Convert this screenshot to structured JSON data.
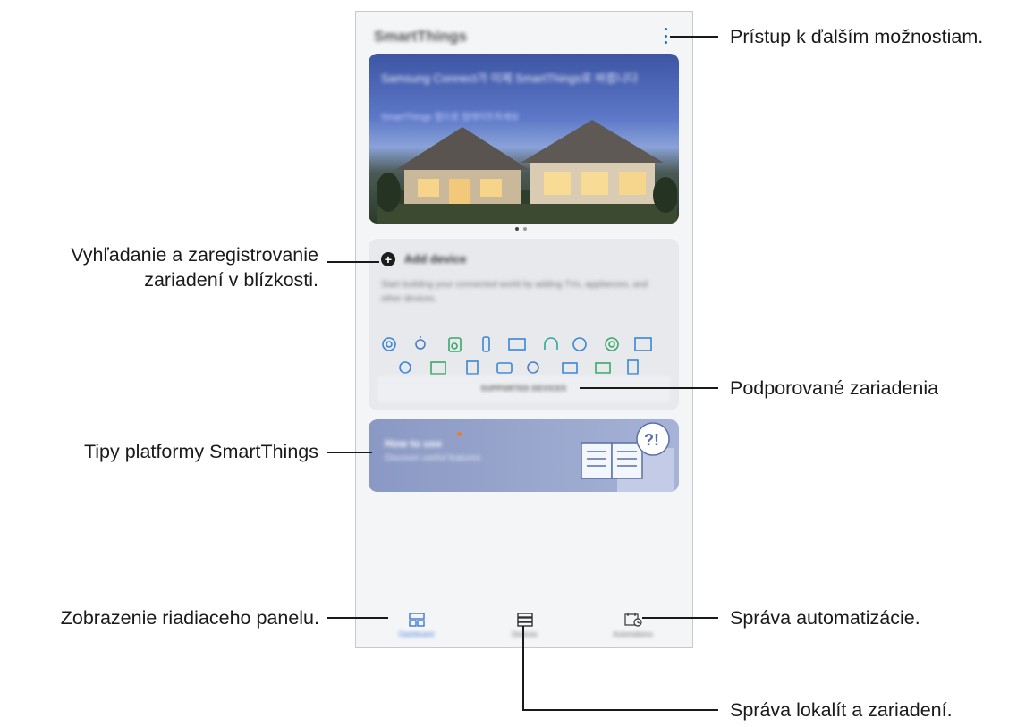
{
  "app": {
    "title": "SmartThings",
    "more_icon": "more-vertical-icon"
  },
  "banner": {
    "title": "Samsung Connect가 이제 SmartThings로 바뀝니다",
    "subtitle": "SmartThings 앱으로 업데이트하세요",
    "page_count": 2,
    "active_page": 1
  },
  "add_device": {
    "icon": "plus-circle-icon",
    "title": "Add device",
    "description": "Start building your connected world by adding TVs, appliances, and other devices.",
    "supported_button": "SUPPORTED DEVICES"
  },
  "tips": {
    "title": "How to use",
    "subtitle": "Discover useful features"
  },
  "bottom_nav": [
    {
      "label": "Dashboard",
      "icon": "dashboard-icon",
      "active": true
    },
    {
      "label": "Devices",
      "icon": "devices-list-icon",
      "active": false
    },
    {
      "label": "Automations",
      "icon": "automation-calendar-icon",
      "active": false
    }
  ],
  "callouts": {
    "more_options": "Prístup k ďalším možnostiam.",
    "find_devices_1": "Vyhľadanie a zaregistrovanie",
    "find_devices_2": "zariadení v blízkosti.",
    "supported_devices": "Podporované zariadenia",
    "tips": "Tipy platformy SmartThings",
    "dashboard": "Zobrazenie riadiaceho panelu.",
    "automation": "Správa automatizácie.",
    "locations": "Správa lokalít a zariadení."
  },
  "colors": {
    "accent": "#1a6ad8",
    "tips_badge": "#f07a2c",
    "nav_active": "#3b78d8"
  }
}
